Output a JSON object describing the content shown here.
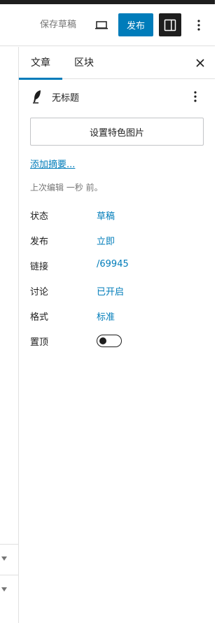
{
  "header": {
    "save_draft_label": "保存草稿",
    "publish_label": "发布"
  },
  "sidebar": {
    "tabs": [
      {
        "label": "文章",
        "active": true
      },
      {
        "label": "区块",
        "active": false
      }
    ],
    "post_title": "无标题",
    "featured_image_label": "设置特色图片",
    "excerpt_link": "添加摘要...",
    "last_edited": "上次编辑 一秒 前。",
    "meta": [
      {
        "label": "状态",
        "value": "草稿"
      },
      {
        "label": "发布",
        "value": "立即"
      },
      {
        "label": "链接",
        "value": "/69945"
      },
      {
        "label": "讨论",
        "value": "已开启"
      },
      {
        "label": "格式",
        "value": "标准"
      }
    ],
    "sticky": {
      "label": "置顶",
      "enabled": false
    }
  },
  "colors": {
    "accent": "#007cba",
    "dark": "#1e1e1e",
    "muted": "#757575",
    "border": "#e0e0e0"
  },
  "icons": [
    "desktop-preview-icon",
    "sidebar-settings-icon",
    "more-vertical-icon",
    "close-icon",
    "feather-icon",
    "caret-down-icon"
  ]
}
